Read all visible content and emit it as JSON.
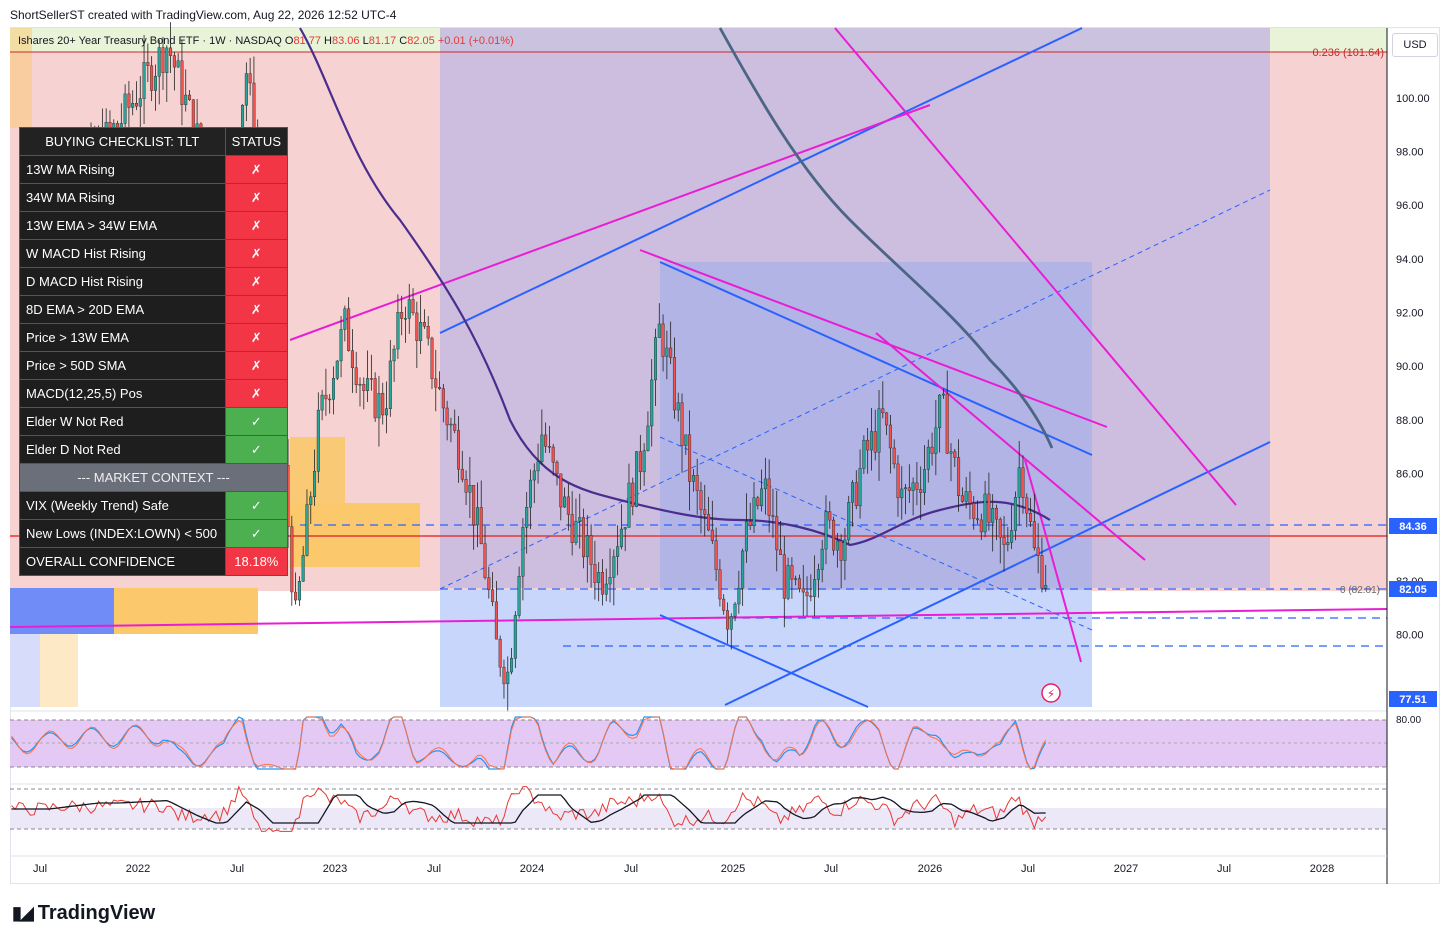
{
  "header": {
    "attribution": "ShortSellerST created with TradingView.com, Aug 22, 2026 12:52 UTC-4"
  },
  "symbol": {
    "name": "Ishares 20+ Year Treasury Bond ETF · 1W · NASDAQ",
    "o_label": "O",
    "open": "81.77",
    "h_label": "H",
    "high": "83.06",
    "l_label": "L",
    "low": "81.17",
    "c_label": "C",
    "close": "82.05",
    "change": "+0.01 (+0.01%)"
  },
  "currency": "USD",
  "fib_label": "0.236 (101.64)",
  "fib_zero_label": "0 (82.01)",
  "price_badges": [
    {
      "value": "84.36",
      "color": "#2962ff"
    },
    {
      "value": "82.05",
      "color": "#2962ff"
    },
    {
      "value": "77.51",
      "color": "#2962ff"
    }
  ],
  "checklist": {
    "title": "BUYING CHECKLIST: TLT",
    "status_header": "STATUS",
    "rows": [
      {
        "label": "13W MA Rising",
        "status": "✗",
        "state": "red"
      },
      {
        "label": "34W MA Rising",
        "status": "✗",
        "state": "red"
      },
      {
        "label": "13W EMA > 34W EMA",
        "status": "✗",
        "state": "red"
      },
      {
        "label": "W MACD Hist Rising",
        "status": "✗",
        "state": "red"
      },
      {
        "label": "D MACD Hist Rising",
        "status": "✗",
        "state": "red"
      },
      {
        "label": "8D EMA > 20D EMA",
        "status": "✗",
        "state": "red"
      },
      {
        "label": "Price > 13W EMA",
        "status": "✗",
        "state": "red"
      },
      {
        "label": "Price > 50D SMA",
        "status": "✗",
        "state": "red"
      },
      {
        "label": "MACD(12,25,5) Pos",
        "status": "✗",
        "state": "red"
      },
      {
        "label": "Elder W Not Red",
        "status": "✓",
        "state": "green"
      },
      {
        "label": "Elder D Not Red",
        "status": "✓",
        "state": "green"
      }
    ],
    "context_header": "--- MARKET CONTEXT ---",
    "context_rows": [
      {
        "label": "VIX (Weekly Trend) Safe",
        "status": "✓",
        "state": "green"
      },
      {
        "label": "New Lows (INDEX:LOWN) < 500",
        "status": "✓",
        "state": "green"
      }
    ],
    "overall_label": "OVERALL CONFIDENCE",
    "overall_value": "18.18%"
  },
  "chart_data": {
    "type": "candlestick",
    "price_axis": {
      "ticks": [
        100.0,
        98.0,
        96.0,
        94.0,
        92.0,
        90.0,
        88.0,
        86.0,
        84.0,
        82.0,
        80.0
      ],
      "ylim": [
        77.3,
        102.6
      ]
    },
    "time_axis": {
      "labels": [
        "Jul",
        "2022",
        "Jul",
        "2023",
        "Jul",
        "2024",
        "Jul",
        "2025",
        "Jul",
        "2026",
        "Jul",
        "2027",
        "Jul",
        "2028"
      ]
    },
    "close_path": [
      [
        2021.55,
        96.0
      ],
      [
        2021.9,
        99.0
      ],
      [
        2022.15,
        102.0
      ],
      [
        2022.3,
        98.5
      ],
      [
        2022.45,
        96.0
      ],
      [
        2022.55,
        101.0
      ],
      [
        2022.62,
        97.0
      ],
      [
        2022.72,
        88.0
      ],
      [
        2022.8,
        80.5
      ],
      [
        2022.92,
        88.0
      ],
      [
        2023.05,
        91.5
      ],
      [
        2023.15,
        89.0
      ],
      [
        2023.25,
        88.5
      ],
      [
        2023.35,
        92.5
      ],
      [
        2023.45,
        91.0
      ],
      [
        2023.55,
        88.5
      ],
      [
        2023.65,
        86.5
      ],
      [
        2023.75,
        83.0
      ],
      [
        2023.82,
        79.5
      ],
      [
        2023.88,
        78.5
      ],
      [
        2023.95,
        84.0
      ],
      [
        2024.05,
        87.5
      ],
      [
        2024.15,
        85.0
      ],
      [
        2024.25,
        83.5
      ],
      [
        2024.35,
        82.0
      ],
      [
        2024.45,
        84.0
      ],
      [
        2024.55,
        86.5
      ],
      [
        2024.65,
        91.5
      ],
      [
        2024.72,
        89.0
      ],
      [
        2024.8,
        86.0
      ],
      [
        2024.9,
        83.5
      ],
      [
        2025.0,
        80.5
      ],
      [
        2025.08,
        83.5
      ],
      [
        2025.18,
        85.5
      ],
      [
        2025.28,
        82.0
      ],
      [
        2025.38,
        81.0
      ],
      [
        2025.48,
        84.0
      ],
      [
        2025.58,
        83.5
      ],
      [
        2025.68,
        86.5
      ],
      [
        2025.78,
        88.0
      ],
      [
        2025.88,
        85.0
      ],
      [
        2025.98,
        86.0
      ],
      [
        2026.08,
        88.5
      ],
      [
        2026.18,
        85.0
      ],
      [
        2026.3,
        84.5
      ],
      [
        2026.4,
        83.0
      ],
      [
        2026.48,
        86.5
      ],
      [
        2026.55,
        83.0
      ],
      [
        2026.62,
        82.05
      ]
    ],
    "indicators": [
      "RSI oscillator (level 80.00)",
      "Smoothed momentum with signal line"
    ],
    "panel_label": "80.00"
  },
  "colors": {
    "bull": "#26a69a",
    "bear": "#ef5350",
    "trend_blue": "#2962ff",
    "magenta": "#e91ed4",
    "ma_purple": "#4a2d8c",
    "ma_slate": "#4b6584"
  },
  "footer": {
    "brand": "TradingView"
  }
}
